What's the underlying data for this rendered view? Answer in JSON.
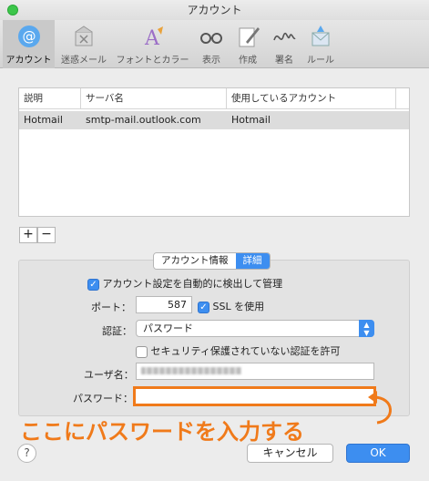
{
  "window": {
    "title": "アカウント"
  },
  "toolbar": {
    "items": [
      {
        "label": "アカウント",
        "icon": "at-icon",
        "active": true
      },
      {
        "label": "迷惑メール",
        "icon": "junk-mail-icon",
        "active": false
      },
      {
        "label": "フォントとカラー",
        "icon": "fonts-colors-icon",
        "active": false
      },
      {
        "label": "表示",
        "icon": "glasses-icon",
        "active": false
      },
      {
        "label": "作成",
        "icon": "compose-icon",
        "active": false
      },
      {
        "label": "署名",
        "icon": "signature-icon",
        "active": false
      },
      {
        "label": "ルール",
        "icon": "rules-icon",
        "active": false
      }
    ]
  },
  "server_table": {
    "columns": [
      "説明",
      "サーバ名",
      "使用しているアカウント"
    ],
    "rows": [
      {
        "description": "Hotmail",
        "server": "smtp-mail.outlook.com",
        "account": "Hotmail"
      }
    ]
  },
  "list_controls": {
    "add": "+",
    "remove": "−"
  },
  "tabs": {
    "account_info": "アカウント情報",
    "details": "詳細"
  },
  "details": {
    "auto_detect_label": "アカウント設定を自動的に検出して管理",
    "auto_detect_checked": true,
    "port_label": "ポート：",
    "port_value": "587",
    "ssl_label": "SSL を使用",
    "ssl_checked": true,
    "auth_label": "認証：",
    "auth_value": "パスワード",
    "insecure_auth_label": "セキュリティ保護されていない認証を許可",
    "insecure_auth_checked": false,
    "username_label": "ユーザ名：",
    "password_label": "パスワード：",
    "password_value": ""
  },
  "annotation": {
    "text": "ここにパスワードを入力する",
    "color": "#f07a1a"
  },
  "buttons": {
    "help": "?",
    "cancel": "キャンセル",
    "ok": "OK"
  },
  "colors": {
    "accent": "#3d8ef0",
    "annotation": "#f07a1a"
  }
}
